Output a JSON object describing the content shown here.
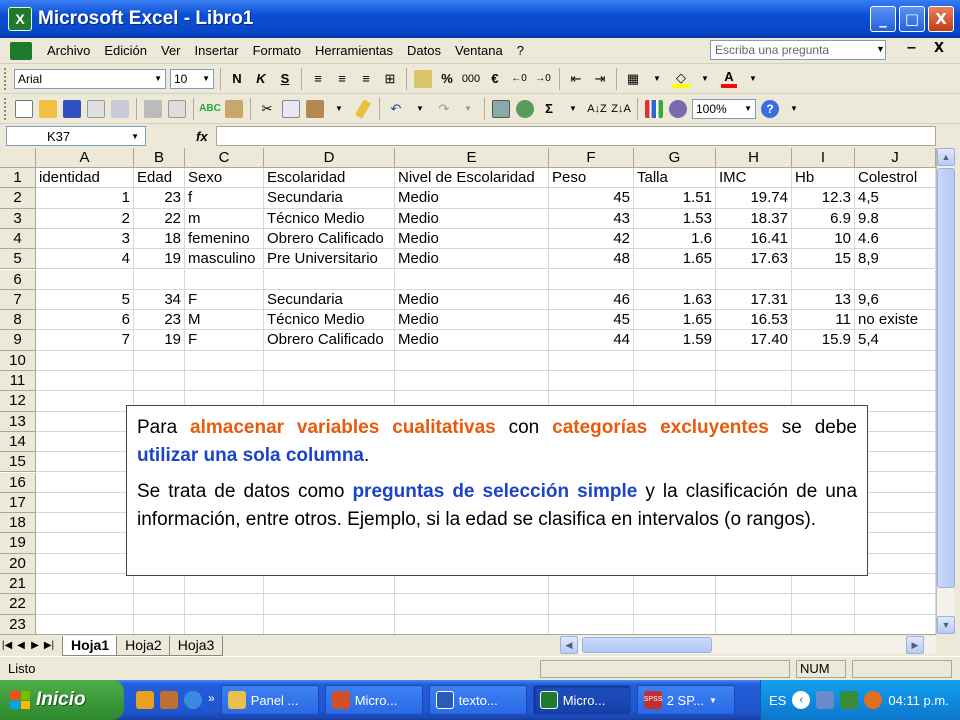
{
  "app": {
    "title": "Microsoft Excel - Libro1",
    "logo": "X"
  },
  "window_buttons": [
    "_",
    "□",
    "X"
  ],
  "menu": [
    "Archivo",
    "Edición",
    "Ver",
    "Insertar",
    "Formato",
    "Herramientas",
    "Datos",
    "Ventana",
    "?"
  ],
  "help_placeholder": "Escriba una pregunta",
  "menu_close_label": "X",
  "format_toolbar": {
    "font": "Arial",
    "size": "10",
    "bold": "N",
    "italic": "K",
    "underline": "S",
    "percent": "%",
    "thousands": "000",
    "euro": "€"
  },
  "standard_toolbar": {
    "zoom": "100%",
    "sum": "Σ"
  },
  "formula_bar": {
    "name_box": "K37",
    "fx": "fx",
    "value": ""
  },
  "columns": [
    "A",
    "B",
    "C",
    "D",
    "E",
    "F",
    "G",
    "H",
    "I",
    "J"
  ],
  "rows": [
    "1",
    "2",
    "3",
    "4",
    "5",
    "6",
    "7",
    "8",
    "9",
    "10",
    "11",
    "12",
    "13",
    "14",
    "15",
    "16",
    "17",
    "18",
    "19",
    "20",
    "21",
    "22",
    "23"
  ],
  "cells": [
    [
      "identidad",
      "Edad",
      "Sexo",
      "Escolaridad",
      "Nivel de Escolaridad",
      "Peso",
      "Talla",
      "IMC",
      "Hb",
      "Colestrol"
    ],
    [
      "1",
      "23",
      "f",
      "Secundaria",
      "Medio",
      "45",
      "1.51",
      "19.74",
      "12.3",
      "4,5"
    ],
    [
      "2",
      "22",
      "m",
      "Técnico Medio",
      "Medio",
      "43",
      "1.53",
      "18.37",
      "6.9",
      "9.8"
    ],
    [
      "3",
      "18",
      "femenino",
      "Obrero Calificado",
      "Medio",
      "42",
      "1.6",
      "16.41",
      "10",
      "4.6"
    ],
    [
      "4",
      "19",
      "masculino",
      "Pre Universitario",
      "Medio",
      "48",
      "1.65",
      "17.63",
      "15",
      "8,9"
    ],
    [
      "",
      "",
      "",
      "",
      "",
      "",
      "",
      "",
      "",
      ""
    ],
    [
      "5",
      "34",
      "F",
      "Secundaria",
      "Medio",
      "46",
      "1.63",
      "17.31",
      "13",
      "9,6"
    ],
    [
      "6",
      "23",
      "M",
      "Técnico Medio",
      "Medio",
      "45",
      "1.65",
      "16.53",
      "11",
      "no existe"
    ],
    [
      "7",
      "19",
      "F",
      "Obrero Calificado",
      "Medio",
      "44",
      "1.59",
      "17.40",
      "15.9",
      "5,4"
    ]
  ],
  "overflow_k": {
    "row1": "C",
    "row3": "3",
    "row4": "3"
  },
  "sheet_tabs": [
    "Hoja1",
    "Hoja2",
    "Hoja3"
  ],
  "status": {
    "ready": "Listo",
    "num": "NUM"
  },
  "taskbar": {
    "start": "Inicio",
    "tasks": [
      "Panel ...",
      "Micro...",
      "texto...",
      "Micro...",
      "2 SP..."
    ],
    "active_task": 3,
    "lang": "ES",
    "clock": "04:11 p.m.",
    "spss_badge": "SPSS",
    "chevron": "»"
  },
  "callout": {
    "p1": {
      "t1": "Para ",
      "h1": "almacenar variables cualitativas",
      "t2": " con ",
      "h2": "categorías excluyentes",
      "t3": " se debe ",
      "h3": "utilizar una sola columna",
      "t4": "."
    },
    "p2": {
      "t1": "Se trata de datos como ",
      "h1": "preguntas de selección simple",
      "t2": " y la clasificación de una información, entre otros. Ejemplo, si la edad se clasifica en intervalos (o rangos)."
    }
  },
  "colors": {
    "accent_orange": "#e85a0c",
    "accent_blue": "#1c44c8",
    "titlebar": "#0a4fd6"
  }
}
